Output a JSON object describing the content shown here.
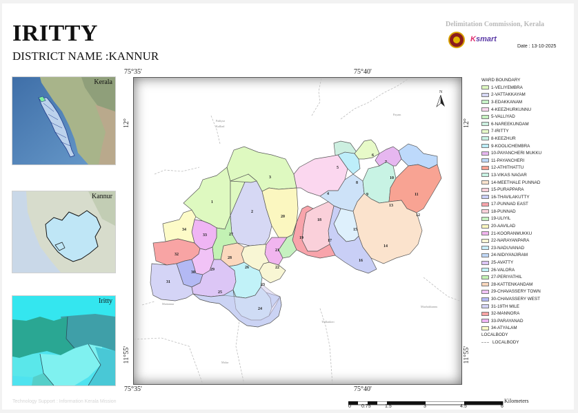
{
  "header": {
    "title": "IRITTY",
    "district": "DISTRICT NAME :KANNUR",
    "commission": "Delimitation Commission, Kerala",
    "logo_k": "K",
    "logo_rest": "smart",
    "date": "Date : 13-10-2025"
  },
  "insets": [
    {
      "label": "Kerala"
    },
    {
      "label": "Kannur"
    },
    {
      "label": "Iritty"
    }
  ],
  "coords": {
    "lon_left": "75°35'",
    "lon_right": "75°40'",
    "lat_upper": "12°",
    "lat_lower": "11°55'"
  },
  "map": {
    "places": {
      "padiyur": "Padiyur",
      "kalliad": "Kalliad",
      "payam": "Payam",
      "mattannur": "Mattannur",
      "thillankeri": "Thillankeri",
      "muzhakkunnu": "Muzhakkunnu",
      "malur": "Malur"
    },
    "ward_numbers": [
      "1",
      "2",
      "3",
      "4",
      "5",
      "6",
      "7",
      "8",
      "9",
      "10",
      "11",
      "12",
      "13",
      "14",
      "15",
      "16",
      "17",
      "18",
      "19",
      "20",
      "21",
      "22",
      "23",
      "24",
      "25",
      "26",
      "27",
      "28",
      "29",
      "30",
      "31",
      "32",
      "33",
      "34"
    ]
  },
  "legend": {
    "ward_heading": "WARD BOUNDARY",
    "wards": [
      {
        "label": "1-VELIYEMBRA",
        "color": "#def9c0"
      },
      {
        "label": "2-VATTAKKAYAM",
        "color": "#d6d8f4"
      },
      {
        "label": "3-EDAKKANAM",
        "color": "#c8f3c8"
      },
      {
        "label": "4-KEEZHURKUNNU",
        "color": "#fbd7ef"
      },
      {
        "label": "5-VALLIYAD",
        "color": "#c6f1c0"
      },
      {
        "label": "6-NAREEKUNDAM",
        "color": "#ccefe0"
      },
      {
        "label": "7-IRITTY",
        "color": "#e7fac8"
      },
      {
        "label": "8-KEEZHUR",
        "color": "#c8f3e4"
      },
      {
        "label": "9-KOOLICHEMBRA",
        "color": "#bdeefa"
      },
      {
        "label": "10-PAYANCHERI MUKKU",
        "color": "#e6b7f0"
      },
      {
        "label": "11-PAYANCHERI",
        "color": "#bdd9fb"
      },
      {
        "label": "12-ATHITHATTU",
        "color": "#f8a393"
      },
      {
        "label": "13-VIKAS NAGAR",
        "color": "#c8f3e4"
      },
      {
        "label": "14-MEETHALE PUNNAD",
        "color": "#fbe3cd"
      },
      {
        "label": "15-PURAPPARA",
        "color": "#fad0da"
      },
      {
        "label": "16-THAVILAKUTTY",
        "color": "#c9cff6"
      },
      {
        "label": "17-PUNNAD EAST",
        "color": "#f8a4ab"
      },
      {
        "label": "18-PUNNAD",
        "color": "#fad0da"
      },
      {
        "label": "19-ULIYIL",
        "color": "#c6f1c0"
      },
      {
        "label": "20-AAVILAD",
        "color": "#fbf7c0"
      },
      {
        "label": "21-KOORANMUKKU",
        "color": "#f1b5ef"
      },
      {
        "label": "22-NARAYANPARA",
        "color": "#f8f6d4"
      },
      {
        "label": "23-NADUVANAD",
        "color": "#c8eefa"
      },
      {
        "label": "24-NIDIYANJIRAM",
        "color": "#c0d8f8"
      },
      {
        "label": "25-AVATTY",
        "color": "#dcc6f6"
      },
      {
        "label": "26-VALORA",
        "color": "#c1f2f8"
      },
      {
        "label": "27-PERIYATHIL",
        "color": "#c3f2b4"
      },
      {
        "label": "28-KATTENKANDAM",
        "color": "#fbd8bd"
      },
      {
        "label": "29-CHAVASSERY TOWN",
        "color": "#f1c3f6"
      },
      {
        "label": "30-CHAVASSERY WEST",
        "color": "#b3b9f4"
      },
      {
        "label": "31-19TH MILE",
        "color": "#d4d4f6"
      },
      {
        "label": "32-MANNORA",
        "color": "#f8a4a4"
      },
      {
        "label": "33-PARAYANAD",
        "color": "#efb5f4"
      },
      {
        "label": "34-ATYALAM",
        "color": "#fdfbc8"
      }
    ],
    "localbody_heading": "LOCALBODY",
    "localbody_item": "LOCALBODY"
  },
  "scale": {
    "ticks": [
      "0",
      "0.75",
      "1.5",
      "3",
      "4.5",
      "6"
    ],
    "unit": "Kilometers"
  },
  "footer": {
    "credit": "Technology Support : Information Kerala Mission"
  }
}
